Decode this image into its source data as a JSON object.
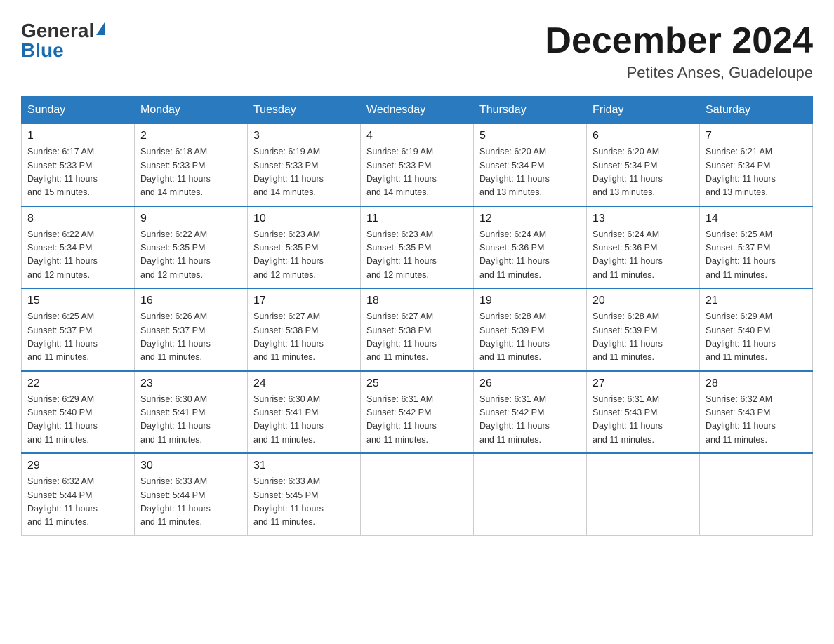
{
  "logo": {
    "general": "General",
    "blue": "Blue"
  },
  "title": "December 2024",
  "location": "Petites Anses, Guadeloupe",
  "days_of_week": [
    "Sunday",
    "Monday",
    "Tuesday",
    "Wednesday",
    "Thursday",
    "Friday",
    "Saturday"
  ],
  "weeks": [
    [
      {
        "day": "1",
        "sunrise": "6:17 AM",
        "sunset": "5:33 PM",
        "daylight": "11 hours and 15 minutes."
      },
      {
        "day": "2",
        "sunrise": "6:18 AM",
        "sunset": "5:33 PM",
        "daylight": "11 hours and 14 minutes."
      },
      {
        "day": "3",
        "sunrise": "6:19 AM",
        "sunset": "5:33 PM",
        "daylight": "11 hours and 14 minutes."
      },
      {
        "day": "4",
        "sunrise": "6:19 AM",
        "sunset": "5:33 PM",
        "daylight": "11 hours and 14 minutes."
      },
      {
        "day": "5",
        "sunrise": "6:20 AM",
        "sunset": "5:34 PM",
        "daylight": "11 hours and 13 minutes."
      },
      {
        "day": "6",
        "sunrise": "6:20 AM",
        "sunset": "5:34 PM",
        "daylight": "11 hours and 13 minutes."
      },
      {
        "day": "7",
        "sunrise": "6:21 AM",
        "sunset": "5:34 PM",
        "daylight": "11 hours and 13 minutes."
      }
    ],
    [
      {
        "day": "8",
        "sunrise": "6:22 AM",
        "sunset": "5:34 PM",
        "daylight": "11 hours and 12 minutes."
      },
      {
        "day": "9",
        "sunrise": "6:22 AM",
        "sunset": "5:35 PM",
        "daylight": "11 hours and 12 minutes."
      },
      {
        "day": "10",
        "sunrise": "6:23 AM",
        "sunset": "5:35 PM",
        "daylight": "11 hours and 12 minutes."
      },
      {
        "day": "11",
        "sunrise": "6:23 AM",
        "sunset": "5:35 PM",
        "daylight": "11 hours and 12 minutes."
      },
      {
        "day": "12",
        "sunrise": "6:24 AM",
        "sunset": "5:36 PM",
        "daylight": "11 hours and 11 minutes."
      },
      {
        "day": "13",
        "sunrise": "6:24 AM",
        "sunset": "5:36 PM",
        "daylight": "11 hours and 11 minutes."
      },
      {
        "day": "14",
        "sunrise": "6:25 AM",
        "sunset": "5:37 PM",
        "daylight": "11 hours and 11 minutes."
      }
    ],
    [
      {
        "day": "15",
        "sunrise": "6:25 AM",
        "sunset": "5:37 PM",
        "daylight": "11 hours and 11 minutes."
      },
      {
        "day": "16",
        "sunrise": "6:26 AM",
        "sunset": "5:37 PM",
        "daylight": "11 hours and 11 minutes."
      },
      {
        "day": "17",
        "sunrise": "6:27 AM",
        "sunset": "5:38 PM",
        "daylight": "11 hours and 11 minutes."
      },
      {
        "day": "18",
        "sunrise": "6:27 AM",
        "sunset": "5:38 PM",
        "daylight": "11 hours and 11 minutes."
      },
      {
        "day": "19",
        "sunrise": "6:28 AM",
        "sunset": "5:39 PM",
        "daylight": "11 hours and 11 minutes."
      },
      {
        "day": "20",
        "sunrise": "6:28 AM",
        "sunset": "5:39 PM",
        "daylight": "11 hours and 11 minutes."
      },
      {
        "day": "21",
        "sunrise": "6:29 AM",
        "sunset": "5:40 PM",
        "daylight": "11 hours and 11 minutes."
      }
    ],
    [
      {
        "day": "22",
        "sunrise": "6:29 AM",
        "sunset": "5:40 PM",
        "daylight": "11 hours and 11 minutes."
      },
      {
        "day": "23",
        "sunrise": "6:30 AM",
        "sunset": "5:41 PM",
        "daylight": "11 hours and 11 minutes."
      },
      {
        "day": "24",
        "sunrise": "6:30 AM",
        "sunset": "5:41 PM",
        "daylight": "11 hours and 11 minutes."
      },
      {
        "day": "25",
        "sunrise": "6:31 AM",
        "sunset": "5:42 PM",
        "daylight": "11 hours and 11 minutes."
      },
      {
        "day": "26",
        "sunrise": "6:31 AM",
        "sunset": "5:42 PM",
        "daylight": "11 hours and 11 minutes."
      },
      {
        "day": "27",
        "sunrise": "6:31 AM",
        "sunset": "5:43 PM",
        "daylight": "11 hours and 11 minutes."
      },
      {
        "day": "28",
        "sunrise": "6:32 AM",
        "sunset": "5:43 PM",
        "daylight": "11 hours and 11 minutes."
      }
    ],
    [
      {
        "day": "29",
        "sunrise": "6:32 AM",
        "sunset": "5:44 PM",
        "daylight": "11 hours and 11 minutes."
      },
      {
        "day": "30",
        "sunrise": "6:33 AM",
        "sunset": "5:44 PM",
        "daylight": "11 hours and 11 minutes."
      },
      {
        "day": "31",
        "sunrise": "6:33 AM",
        "sunset": "5:45 PM",
        "daylight": "11 hours and 11 minutes."
      },
      null,
      null,
      null,
      null
    ]
  ],
  "labels": {
    "sunrise": "Sunrise:",
    "sunset": "Sunset:",
    "daylight": "Daylight:"
  }
}
